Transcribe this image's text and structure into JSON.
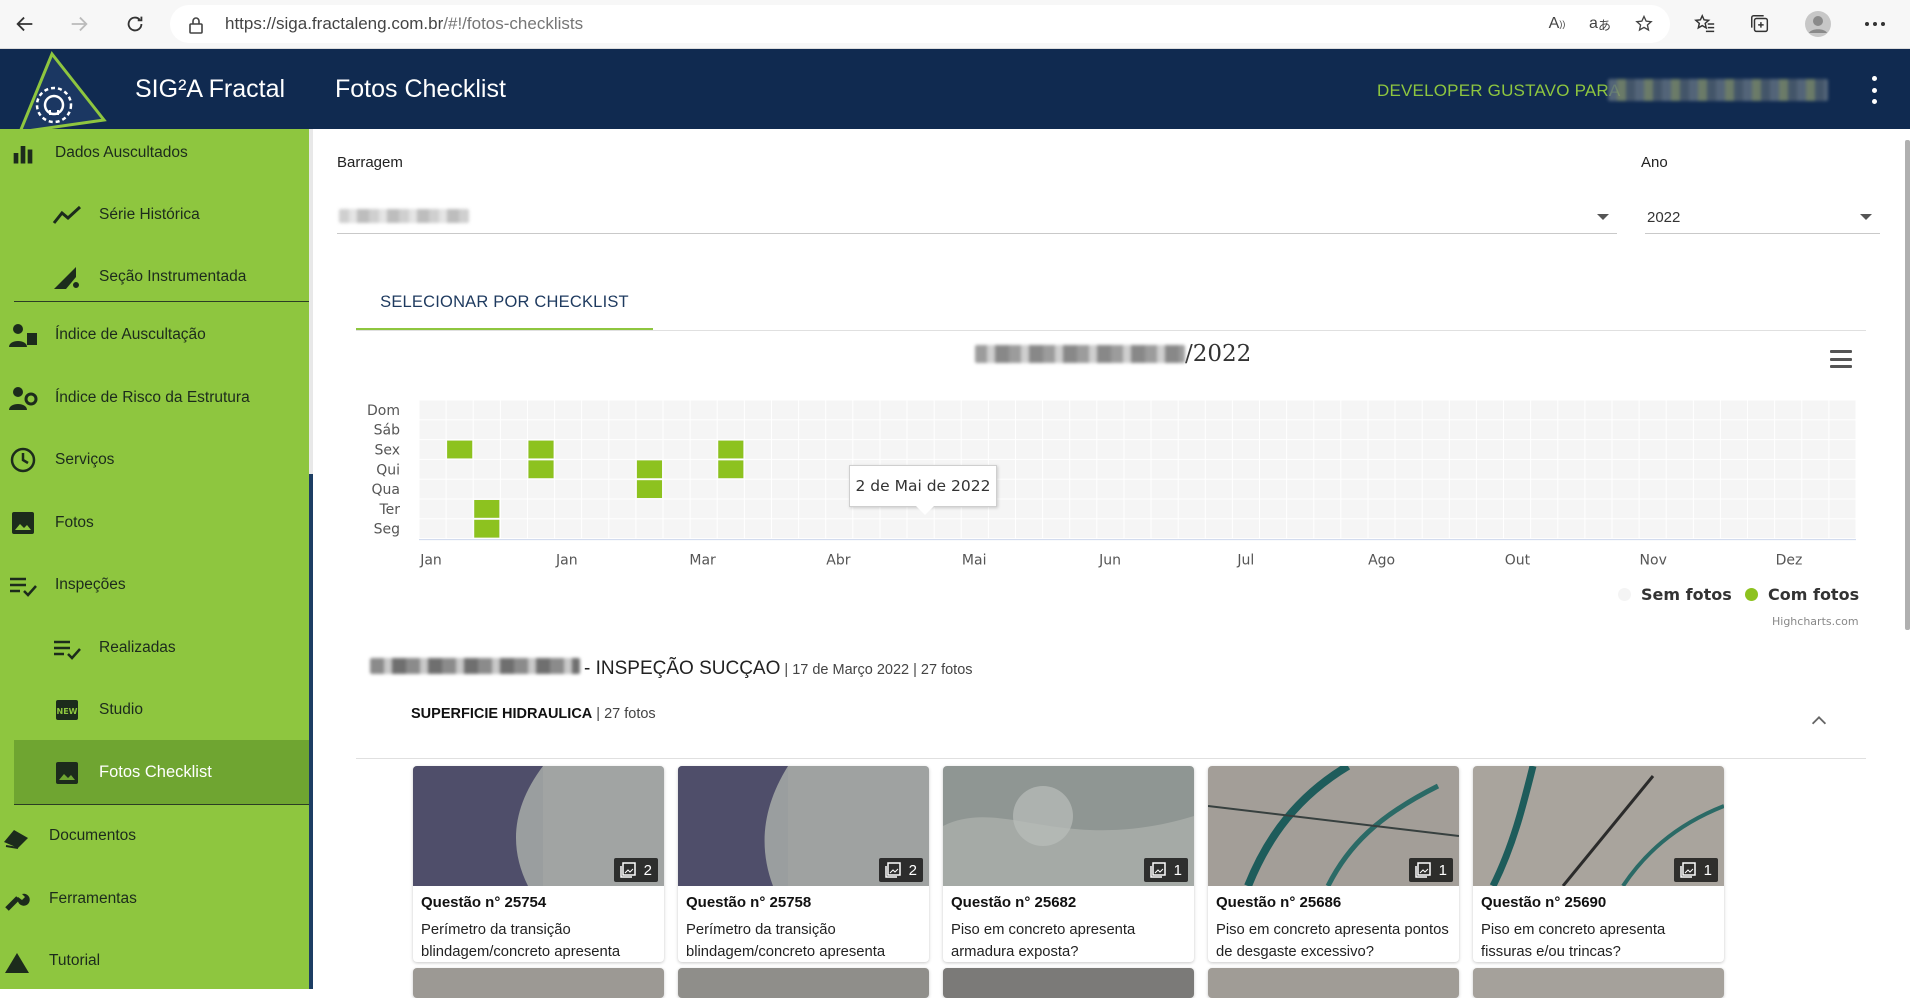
{
  "browser": {
    "url_host": "https://siga.fractaleng.com.br",
    "url_path": "/#!/fotos-checklists"
  },
  "header": {
    "brand": "SIG²A Fractal",
    "page_title": "Fotos Checklist",
    "user": "DEVELOPER GUSTAVO PARA"
  },
  "sidebar": {
    "items": [
      {
        "label": "Dados Auscultados",
        "icon": "bar-chart-icon"
      },
      {
        "label": "Série Histórica",
        "icon": "trend-icon"
      },
      {
        "label": "Seção Instrumentada",
        "icon": "section-gear-icon"
      },
      {
        "label": "Índice de Auscultação",
        "icon": "worker-icon"
      },
      {
        "label": "Índice de Risco da Estrutura",
        "icon": "worker-gear-icon"
      },
      {
        "label": "Serviços",
        "icon": "clock-icon"
      },
      {
        "label": "Fotos",
        "icon": "image-icon"
      },
      {
        "label": "Inspeções",
        "icon": "checklist-icon"
      },
      {
        "label": "Realizadas",
        "icon": "checklist-icon"
      },
      {
        "label": "Studio",
        "icon": "new-badge-icon"
      },
      {
        "label": "Fotos Checklist",
        "icon": "image-icon"
      },
      {
        "label": "Documentos",
        "icon": "books-icon"
      },
      {
        "label": "Ferramentas",
        "icon": "wrench-icon"
      },
      {
        "label": "Tutorial",
        "icon": "tutorial-icon"
      }
    ]
  },
  "filters": {
    "barragem_label": "Barragem",
    "ano_label": "Ano",
    "ano_value": "2022"
  },
  "tabs": {
    "checklist": "SELECIONAR POR CHECKLIST"
  },
  "chart_data": {
    "type": "heatmap",
    "title": "/2022",
    "y_categories": [
      "Dom",
      "Sáb",
      "Sex",
      "Qui",
      "Qua",
      "Ter",
      "Seg"
    ],
    "x_tick_labels": [
      "Jan",
      "Jan",
      "Mar",
      "Abr",
      "Mai",
      "Jun",
      "Jul",
      "Ago",
      "Out",
      "Nov",
      "Dez"
    ],
    "weeks": 53,
    "cells_with_photos": [
      {
        "week": 1,
        "day": "Sex"
      },
      {
        "week": 2,
        "day": "Ter"
      },
      {
        "week": 2,
        "day": "Seg"
      },
      {
        "week": 4,
        "day": "Sex"
      },
      {
        "week": 4,
        "day": "Qui"
      },
      {
        "week": 8,
        "day": "Qui"
      },
      {
        "week": 8,
        "day": "Qua"
      },
      {
        "week": 11,
        "day": "Sex"
      },
      {
        "week": 11,
        "day": "Qui"
      }
    ],
    "legend": [
      {
        "name": "Sem fotos",
        "color": "#f4f4f4"
      },
      {
        "name": "Com fotos",
        "color": "#8dc21f"
      }
    ],
    "tooltip": "2 de Mai de 2022",
    "credits": "Highcharts.com"
  },
  "group": {
    "title": "- INSPEÇÃO SUCÇAO",
    "meta": "| 17 de Março 2022 | 27 fotos",
    "subgroup_name": "SUPERFICIE HIDRAULICA",
    "subgroup_count": "| 27 fotos"
  },
  "cards": [
    {
      "count": "2",
      "question": "Questão n° 25754",
      "desc": "Perímetro da transição blindagem/concreto apresenta"
    },
    {
      "count": "2",
      "question": "Questão n° 25758",
      "desc": "Perímetro da transição blindagem/concreto apresenta"
    },
    {
      "count": "1",
      "question": "Questão n° 25682",
      "desc": "Piso em concreto apresenta armadura exposta?"
    },
    {
      "count": "1",
      "question": "Questão n° 25686",
      "desc": "Piso em concreto apresenta pontos de desgaste excessivo?"
    },
    {
      "count": "1",
      "question": "Questão n° 25690",
      "desc": "Piso em concreto apresenta fissuras e/ou trincas?"
    }
  ],
  "colors": {
    "appbar": "#102a50",
    "sidebar": "#8ec63f",
    "sidebar_active": "#6fa531",
    "accent": "#8dc21f"
  }
}
